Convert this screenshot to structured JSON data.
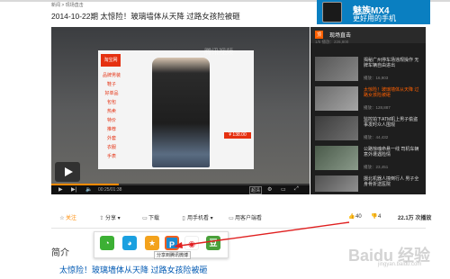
{
  "breadcrumb": "新闻 > 现场直击",
  "page_title": "2014-10-22期 太惊险！玻璃墙体从天降 过路女孩险被砸",
  "ad": {
    "line1": "魅族MX4",
    "line2": "更好用的手机"
  },
  "player": {
    "watermark": "腾讯视频",
    "shop": {
      "logo": "淘宝网",
      "categories": [
        "品牌男装",
        "鞋子",
        "好单品",
        "包包",
        "热卖",
        "特价",
        "推荐",
        "外套",
        "衣服",
        "手表"
      ],
      "price": "¥ 138.00"
    },
    "time": "00:25/01:38",
    "hd": "超清",
    "progress": 0.26
  },
  "sidebar": {
    "badge": "顶",
    "title": "现场直击",
    "subtitle": "1/5  播放：226,800",
    "items": [
      {
        "title": "揭秘广州停车场违规操作 无牌车辆自由进出",
        "plays": "播放：16,903"
      },
      {
        "title": "太惊险！玻璃墙体从天降 过路女孩险被砸",
        "plays": "播放：128,887"
      },
      {
        "title": "监控拍下ATM机上男子偷盗 事发时众人围观",
        "plays": "播放：44,432"
      },
      {
        "title": "公路惊魂命悬一线 司机车辆意外遭遇险情",
        "plays": "播放：23,451"
      },
      {
        "title": "摄北机器人撞倒行人 男子全身骨折送医院",
        "plays": "播放：31,506"
      }
    ]
  },
  "actions": {
    "favorite": "关注",
    "share": "分享",
    "download": "下载",
    "mobile": "用手机看",
    "client": "用客户端看",
    "likes": "40",
    "dislikes": "4",
    "views": "22.1万 次播放"
  },
  "share_popup": {
    "tooltip": "分享到腾讯微博"
  },
  "intro": {
    "title": "简介",
    "desc": "太惊险！玻璃墙体从天降 过路女孩险被砸"
  },
  "watermark": {
    "site": "Baidu 经验",
    "url": "jingyan.baidu.com"
  }
}
